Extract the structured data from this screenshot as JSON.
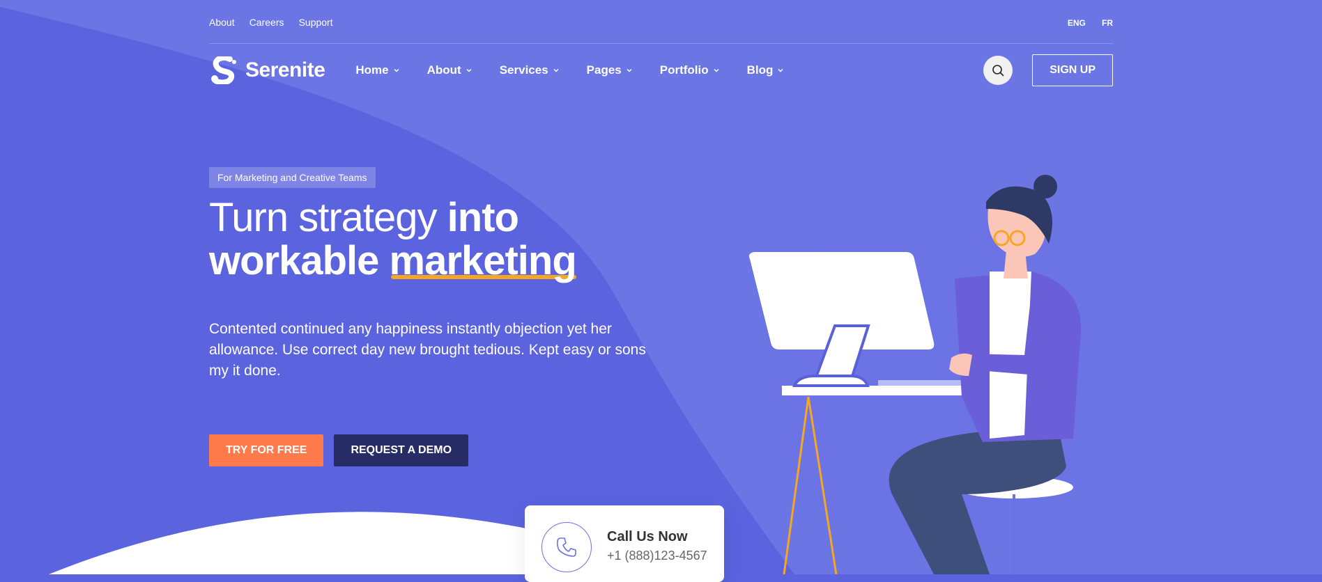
{
  "top_links": [
    "About",
    "Careers",
    "Support"
  ],
  "languages": [
    "ENG",
    "FR"
  ],
  "brand": {
    "name": "Serenite"
  },
  "nav": {
    "items": [
      "Home",
      "About",
      "Services",
      "Pages",
      "Portfolio",
      "Blog"
    ],
    "signup_label": "SIGN UP"
  },
  "hero": {
    "badge": "For Marketing and Creative Teams",
    "title_light": "Turn strategy ",
    "title_bold_1": "into",
    "title_bold_2": "workable ",
    "title_highlight": "marketing",
    "lead": "Contented continued any happiness instantly objection yet her allowance. Use correct day new brought tedious. Kept easy or sons my it done.",
    "cta_primary": "TRY FOR FREE",
    "cta_secondary": "REQUEST A DEMO"
  },
  "call": {
    "title": "Call Us Now",
    "phone": "+1 (888)123-4567"
  },
  "colors": {
    "background": "#5b63df",
    "accent_orange": "#ff7a4b",
    "accent_navy": "#262d66",
    "highlight": "#f5a623"
  },
  "icons": {
    "logo": "serenite-logo-icon",
    "search": "search-icon",
    "phone": "phone-icon",
    "chevron": "chevron-down-icon"
  }
}
